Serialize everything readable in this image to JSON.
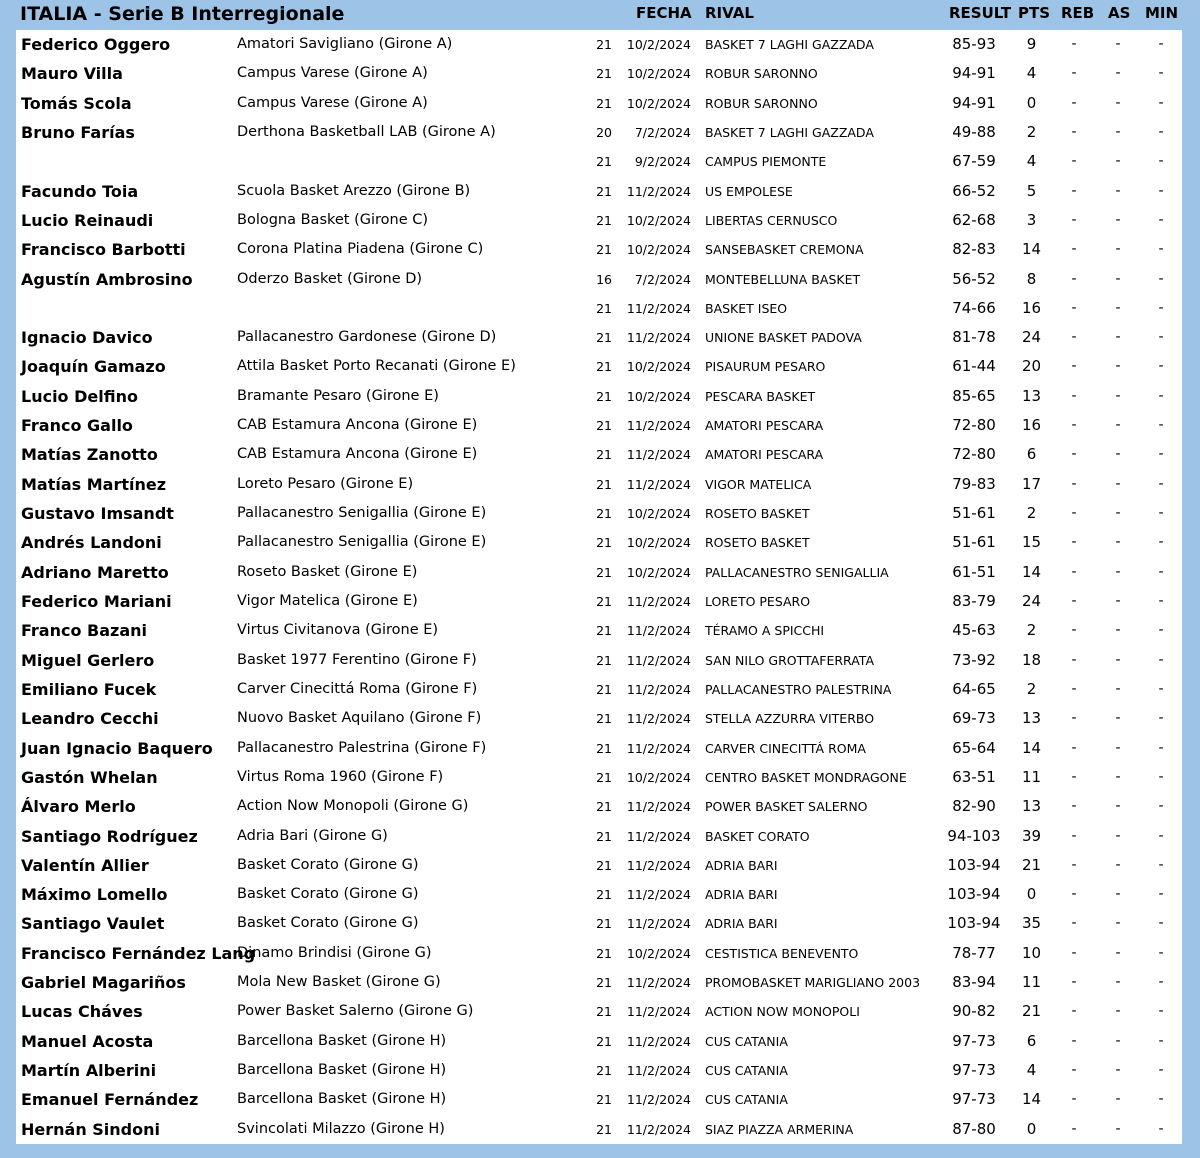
{
  "header": {
    "title": "ITALIA - Serie B Interregionale",
    "fecha": "FECHA",
    "rival": "RIVAL",
    "result": "RESULT",
    "pts": "PTS",
    "reb": "REB",
    "as": "AS",
    "min": "MIN"
  },
  "colors": {
    "background": "#9dc3e6",
    "table": "#ffffff"
  },
  "rows": [
    {
      "player": "Federico Oggero",
      "team": "Amatori Savigliano (Girone A)",
      "round": "21",
      "date": "10/2/2024",
      "rival": "BASKET 7 LAGHI GAZZADA",
      "result": "85-93",
      "pts": "9",
      "reb": "-",
      "as": "-",
      "min": "-"
    },
    {
      "player": "Mauro Villa",
      "team": "Campus Varese (Girone A)",
      "round": "21",
      "date": "10/2/2024",
      "rival": "ROBUR SARONNO",
      "result": "94-91",
      "pts": "4",
      "reb": "-",
      "as": "-",
      "min": "-"
    },
    {
      "player": "Tomás Scola",
      "team": "Campus Varese (Girone A)",
      "round": "21",
      "date": "10/2/2024",
      "rival": "ROBUR SARONNO",
      "result": "94-91",
      "pts": "0",
      "reb": "-",
      "as": "-",
      "min": "-"
    },
    {
      "player": "Bruno Farías",
      "team": "Derthona Basketball LAB (Girone A)",
      "round": "20",
      "date": "7/2/2024",
      "rival": "BASKET 7 LAGHI GAZZADA",
      "result": "49-88",
      "pts": "2",
      "reb": "-",
      "as": "-",
      "min": "-"
    },
    {
      "player": "",
      "team": "",
      "round": "21",
      "date": "9/2/2024",
      "rival": "CAMPUS PIEMONTE",
      "result": "67-59",
      "pts": "4",
      "reb": "-",
      "as": "-",
      "min": "-"
    },
    {
      "player": "Facundo Toia",
      "team": "Scuola Basket Arezzo (Girone B)",
      "round": "21",
      "date": "11/2/2024",
      "rival": "US EMPOLESE",
      "result": "66-52",
      "pts": "5",
      "reb": "-",
      "as": "-",
      "min": "-"
    },
    {
      "player": "Lucio Reinaudi",
      "team": "Bologna Basket (Girone C)",
      "round": "21",
      "date": "10/2/2024",
      "rival": "LIBERTAS CERNUSCO",
      "result": "62-68",
      "pts": "3",
      "reb": "-",
      "as": "-",
      "min": "-"
    },
    {
      "player": "Francisco Barbotti",
      "team": "Corona Platina Piadena (Girone C)",
      "round": "21",
      "date": "10/2/2024",
      "rival": "SANSEBASKET CREMONA",
      "result": "82-83",
      "pts": "14",
      "reb": "-",
      "as": "-",
      "min": "-"
    },
    {
      "player": "Agustín Ambrosino",
      "team": "Oderzo Basket (Girone D)",
      "round": "16",
      "date": "7/2/2024",
      "rival": "MONTEBELLUNA BASKET",
      "result": "56-52",
      "pts": "8",
      "reb": "-",
      "as": "-",
      "min": "-"
    },
    {
      "player": "",
      "team": "",
      "round": "21",
      "date": "11/2/2024",
      "rival": "BASKET ISEO",
      "result": "74-66",
      "pts": "16",
      "reb": "-",
      "as": "-",
      "min": "-"
    },
    {
      "player": "Ignacio Davico",
      "team": "Pallacanestro Gardonese (Girone D)",
      "round": "21",
      "date": "11/2/2024",
      "rival": "UNIONE BASKET PADOVA",
      "result": "81-78",
      "pts": "24",
      "reb": "-",
      "as": "-",
      "min": "-"
    },
    {
      "player": "Joaquín Gamazo",
      "team": "Attila Basket Porto Recanati (Girone E)",
      "round": "21",
      "date": "10/2/2024",
      "rival": "PISAURUM PESARO",
      "result": "61-44",
      "pts": "20",
      "reb": "-",
      "as": "-",
      "min": "-"
    },
    {
      "player": "Lucio Delfino",
      "team": "Bramante Pesaro (Girone E)",
      "round": "21",
      "date": "10/2/2024",
      "rival": "PESCARA BASKET",
      "result": "85-65",
      "pts": "13",
      "reb": "-",
      "as": "-",
      "min": "-"
    },
    {
      "player": "Franco Gallo",
      "team": "CAB Estamura Ancona (Girone E)",
      "round": "21",
      "date": "11/2/2024",
      "rival": "AMATORI PESCARA",
      "result": "72-80",
      "pts": "16",
      "reb": "-",
      "as": "-",
      "min": "-"
    },
    {
      "player": "Matías Zanotto",
      "team": "CAB Estamura Ancona (Girone E)",
      "round": "21",
      "date": "11/2/2024",
      "rival": "AMATORI PESCARA",
      "result": "72-80",
      "pts": "6",
      "reb": "-",
      "as": "-",
      "min": "-"
    },
    {
      "player": "Matías Martínez",
      "team": "Loreto Pesaro (Girone E)",
      "round": "21",
      "date": "11/2/2024",
      "rival": "VIGOR MATELICA",
      "result": "79-83",
      "pts": "17",
      "reb": "-",
      "as": "-",
      "min": "-"
    },
    {
      "player": "Gustavo Imsandt",
      "team": "Pallacanestro Senigallia (Girone E)",
      "round": "21",
      "date": "10/2/2024",
      "rival": "ROSETO BASKET",
      "result": "51-61",
      "pts": "2",
      "reb": "-",
      "as": "-",
      "min": "-"
    },
    {
      "player": "Andrés Landoni",
      "team": "Pallacanestro Senigallia (Girone E)",
      "round": "21",
      "date": "10/2/2024",
      "rival": "ROSETO BASKET",
      "result": "51-61",
      "pts": "15",
      "reb": "-",
      "as": "-",
      "min": "-"
    },
    {
      "player": "Adriano Maretto",
      "team": "Roseto Basket (Girone E)",
      "round": "21",
      "date": "10/2/2024",
      "rival": "PALLACANESTRO SENIGALLIA",
      "result": "61-51",
      "pts": "14",
      "reb": "-",
      "as": "-",
      "min": "-"
    },
    {
      "player": "Federico Mariani",
      "team": "Vigor Matelica (Girone E)",
      "round": "21",
      "date": "11/2/2024",
      "rival": "LORETO PESARO",
      "result": "83-79",
      "pts": "24",
      "reb": "-",
      "as": "-",
      "min": "-"
    },
    {
      "player": "Franco Bazani",
      "team": "Virtus Civitanova (Girone E)",
      "round": "21",
      "date": "11/2/2024",
      "rival": "TÉRAMO A SPICCHI",
      "result": "45-63",
      "pts": "2",
      "reb": "-",
      "as": "-",
      "min": "-"
    },
    {
      "player": "Miguel Gerlero",
      "team": "Basket 1977 Ferentino (Girone F)",
      "round": "21",
      "date": "11/2/2024",
      "rival": "SAN NILO GROTTAFERRATA",
      "result": "73-92",
      "pts": "18",
      "reb": "-",
      "as": "-",
      "min": "-"
    },
    {
      "player": "Emiliano Fucek",
      "team": "Carver Cinecittá Roma (Girone F)",
      "round": "21",
      "date": "11/2/2024",
      "rival": "PALLACANESTRO PALESTRINA",
      "result": "64-65",
      "pts": "2",
      "reb": "-",
      "as": "-",
      "min": "-"
    },
    {
      "player": "Leandro Cecchi",
      "team": "Nuovo Basket Aquilano (Girone F)",
      "round": "21",
      "date": "11/2/2024",
      "rival": "STELLA AZZURRA VITERBO",
      "result": "69-73",
      "pts": "13",
      "reb": "-",
      "as": "-",
      "min": "-"
    },
    {
      "player": "Juan Ignacio Baquero",
      "team": "Pallacanestro Palestrina (Girone F)",
      "round": "21",
      "date": "11/2/2024",
      "rival": "CARVER CINECITTÁ ROMA",
      "result": "65-64",
      "pts": "14",
      "reb": "-",
      "as": "-",
      "min": "-"
    },
    {
      "player": "Gastón Whelan",
      "team": "Virtus Roma 1960 (Girone F)",
      "round": "21",
      "date": "10/2/2024",
      "rival": "CENTRO BASKET MONDRAGONE",
      "result": "63-51",
      "pts": "11",
      "reb": "-",
      "as": "-",
      "min": "-"
    },
    {
      "player": "Álvaro Merlo",
      "team": "Action Now Monopoli (Girone G)",
      "round": "21",
      "date": "11/2/2024",
      "rival": "POWER BASKET SALERNO",
      "result": "82-90",
      "pts": "13",
      "reb": "-",
      "as": "-",
      "min": "-"
    },
    {
      "player": "Santiago Rodríguez",
      "team": "Adria Bari (Girone G)",
      "round": "21",
      "date": "11/2/2024",
      "rival": "BASKET CORATO",
      "result": "94-103",
      "pts": "39",
      "reb": "-",
      "as": "-",
      "min": "-"
    },
    {
      "player": "Valentín Allier",
      "team": "Basket Corato (Girone G)",
      "round": "21",
      "date": "11/2/2024",
      "rival": "ADRIA BARI",
      "result": "103-94",
      "pts": "21",
      "reb": "-",
      "as": "-",
      "min": "-"
    },
    {
      "player": "Máximo Lomello",
      "team": "Basket Corato (Girone G)",
      "round": "21",
      "date": "11/2/2024",
      "rival": "ADRIA BARI",
      "result": "103-94",
      "pts": "0",
      "reb": "-",
      "as": "-",
      "min": "-"
    },
    {
      "player": "Santiago Vaulet",
      "team": "Basket Corato (Girone G)",
      "round": "21",
      "date": "11/2/2024",
      "rival": "ADRIA BARI",
      "result": "103-94",
      "pts": "35",
      "reb": "-",
      "as": "-",
      "min": "-"
    },
    {
      "player": "Francisco Fernández Lang",
      "team": "Dinamo Brindisi (Girone G)",
      "round": "21",
      "date": "10/2/2024",
      "rival": "CESTISTICA BENEVENTO",
      "result": "78-77",
      "pts": "10",
      "reb": "-",
      "as": "-",
      "min": "-"
    },
    {
      "player": "Gabriel Magariños",
      "team": "Mola New Basket (Girone G)",
      "round": "21",
      "date": "11/2/2024",
      "rival": "PROMOBASKET MARIGLIANO 2003",
      "result": "83-94",
      "pts": "11",
      "reb": "-",
      "as": "-",
      "min": "-"
    },
    {
      "player": "Lucas Cháves",
      "team": "Power Basket Salerno (Girone G)",
      "round": "21",
      "date": "11/2/2024",
      "rival": "ACTION NOW MONOPOLI",
      "result": "90-82",
      "pts": "21",
      "reb": "-",
      "as": "-",
      "min": "-"
    },
    {
      "player": "Manuel Acosta",
      "team": "Barcellona Basket (Girone H)",
      "round": "21",
      "date": "11/2/2024",
      "rival": "CUS CATANIA",
      "result": "97-73",
      "pts": "6",
      "reb": "-",
      "as": "-",
      "min": "-"
    },
    {
      "player": "Martín Alberini",
      "team": "Barcellona Basket (Girone H)",
      "round": "21",
      "date": "11/2/2024",
      "rival": "CUS CATANIA",
      "result": "97-73",
      "pts": "4",
      "reb": "-",
      "as": "-",
      "min": "-"
    },
    {
      "player": "Emanuel Fernández",
      "team": "Barcellona Basket (Girone H)",
      "round": "21",
      "date": "11/2/2024",
      "rival": "CUS CATANIA",
      "result": "97-73",
      "pts": "14",
      "reb": "-",
      "as": "-",
      "min": "-"
    },
    {
      "player": "Hernán Sindoni",
      "team": "Svincolati Milazzo (Girone H)",
      "round": "21",
      "date": "11/2/2024",
      "rival": "SIAZ PIAZZA ARMERINA",
      "result": "87-80",
      "pts": "0",
      "reb": "-",
      "as": "-",
      "min": "-"
    }
  ]
}
